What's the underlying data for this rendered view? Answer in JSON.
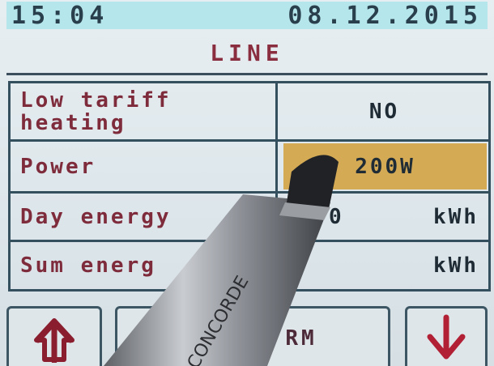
{
  "status_bar": {
    "time": "15:04",
    "date": "08.12.2015"
  },
  "screen_title": "LINE",
  "rows": [
    {
      "label_line1": "Low tariff",
      "label_line2": "heating",
      "value": "NO"
    },
    {
      "label": "Power",
      "value": "200W"
    },
    {
      "label": "Day energy",
      "value": "0",
      "unit": "kWh"
    },
    {
      "label": "Sum energ",
      "unit": "kWh"
    }
  ],
  "buttons": {
    "confirm_label": "RM",
    "up_icon": "arrow-up-icon",
    "down_icon": "arrow-down-icon"
  },
  "colors": {
    "accent_red": "#8a2d3f",
    "highlight": "#d4aa55",
    "status_bar": "#b5e6ec"
  }
}
